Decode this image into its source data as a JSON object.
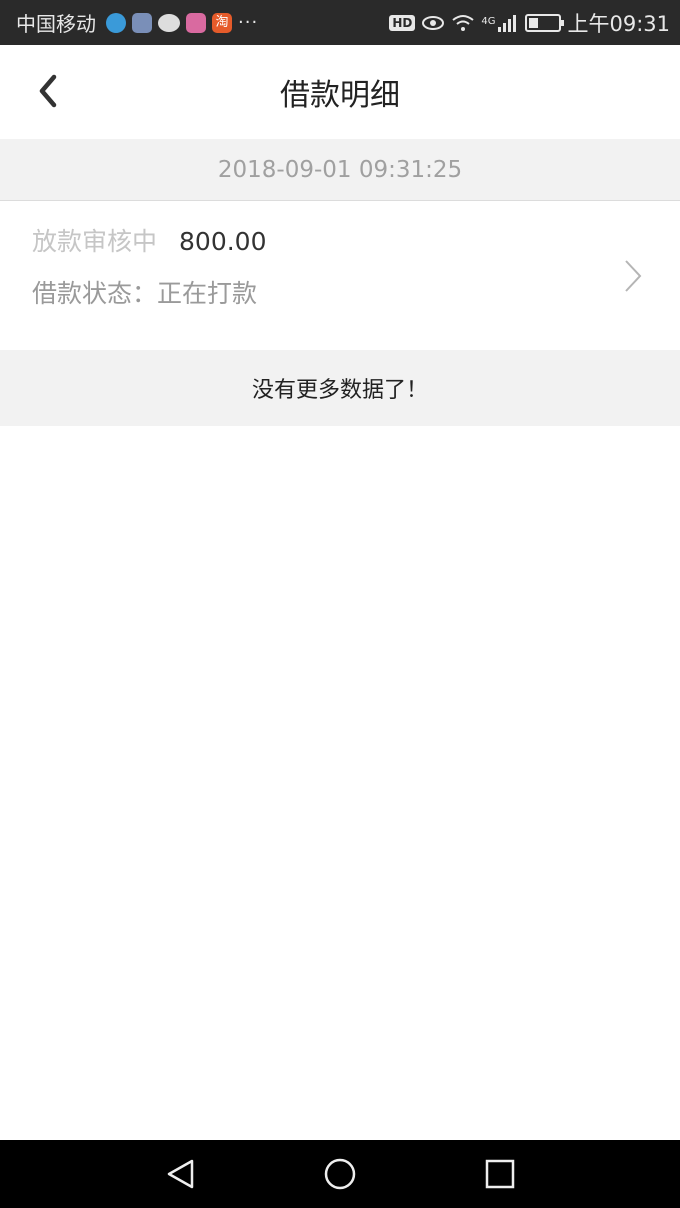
{
  "status_bar": {
    "carrier": "中国移动",
    "more": "···",
    "hd": "HD",
    "network": "4G",
    "time": "上午09:31",
    "icons": [
      "qq-browser-icon",
      "shield-icon",
      "chat-icon",
      "pink-app-icon",
      "taobao-icon",
      "eye-icon",
      "wifi-icon",
      "signal-icon",
      "battery-icon"
    ],
    "taobao_glyph": "淘"
  },
  "header": {
    "title": "借款明细",
    "back_icon": "chevron-left-icon"
  },
  "records": [
    {
      "datetime": "2018-09-01 09:31:25",
      "status_label": "放款审核中",
      "amount": "800.00",
      "loan_status": "借款状态：正在打款"
    }
  ],
  "list_end_text": "没有更多数据了！",
  "nav": {
    "back_icon": "nav-back-icon",
    "home_icon": "nav-home-icon",
    "recent_icon": "nav-recent-icon"
  },
  "colors": {
    "status_bar_bg": "#2a2a2a",
    "strip_bg": "#f2f2f2",
    "muted_text": "#a0a0a0"
  }
}
